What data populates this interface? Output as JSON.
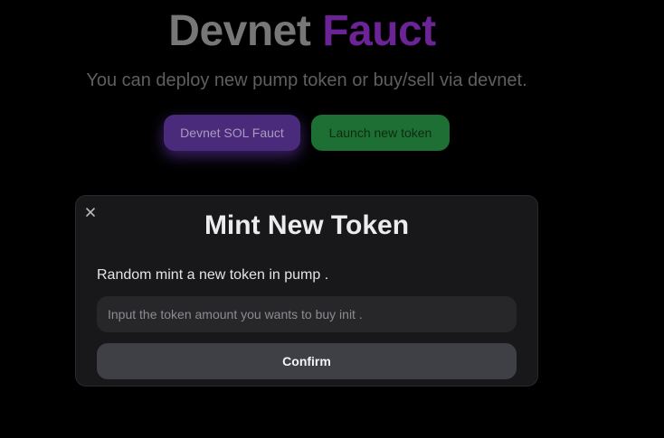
{
  "hero": {
    "title_part1": "Devnet",
    "title_part2": "Fauct",
    "subtitle": "You can deploy new pump token or buy/sell via devnet."
  },
  "actions": {
    "faucet_label": "Devnet SOL Fauct",
    "launch_label": "Launch new token"
  },
  "modal": {
    "close_icon": "close-icon",
    "title": "Mint New Token",
    "description": "Random mint a new token in pump .",
    "amount_input": {
      "value": "",
      "placeholder": "Input the token amount you wants to buy init ."
    },
    "confirm_label": "Confirm"
  },
  "colors": {
    "background": "#000000",
    "title_gray": "#777777",
    "title_purple": "#6b2396",
    "faucet_button": "#4a2a7a",
    "launch_button": "#1e6f33",
    "modal_background": "#18181b",
    "input_background": "#27272a",
    "confirm_button": "#3f3f46"
  }
}
